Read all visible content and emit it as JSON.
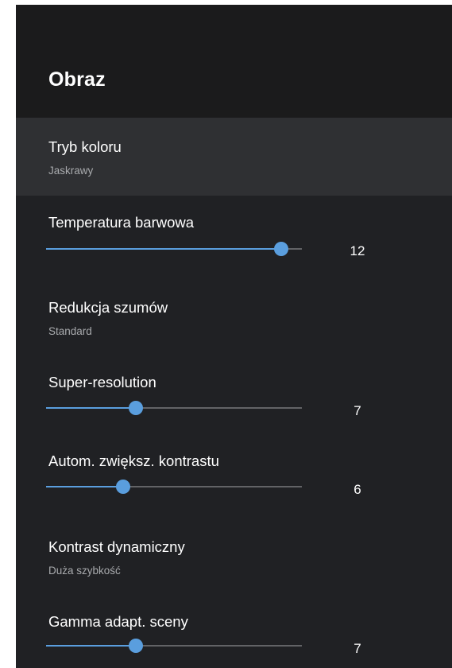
{
  "header": {
    "title": "Obraz"
  },
  "settings": {
    "color_mode": {
      "label": "Tryb koloru",
      "value": "Jaskrawy",
      "selected": true
    },
    "color_temperature": {
      "label": "Temperatura barwowa",
      "value": "12",
      "level": 0.92
    },
    "noise_reduction": {
      "label": "Redukcja szumów",
      "value": "Standard"
    },
    "super_resolution": {
      "label": "Super-resolution",
      "value": "7",
      "level": 0.35
    },
    "auto_contrast": {
      "label": "Autom. zwiększ. kontrastu",
      "value": "6",
      "level": 0.3
    },
    "dynamic_contrast": {
      "label": "Kontrast dynamiczny",
      "value": "Duża szybkość"
    },
    "scene_gamma": {
      "label": "Gamma adapt. sceny",
      "value": "7",
      "level": 0.35
    }
  },
  "colors": {
    "accent": "#5a9ede",
    "background": "#202124",
    "header": "#1b1b1c",
    "selected_row": "#2f3033"
  }
}
